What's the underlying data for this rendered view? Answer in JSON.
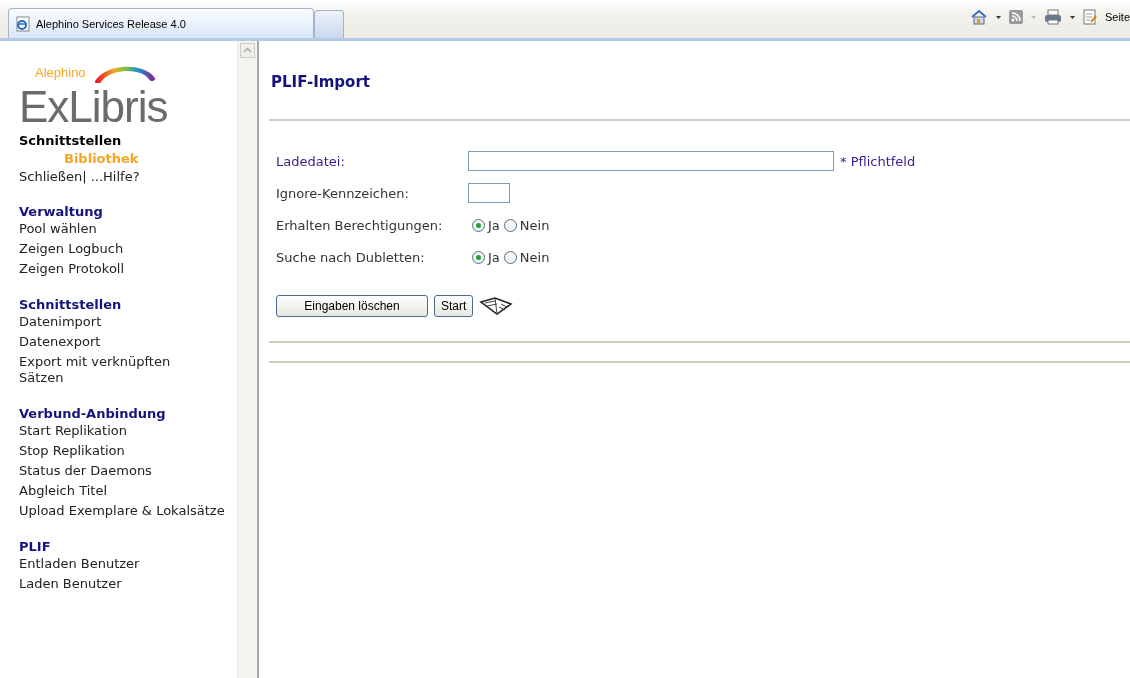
{
  "browser": {
    "tabs": [
      {
        "title": "Alephino Services Release 4.0",
        "selected": true
      },
      {
        "selected": false
      }
    ],
    "toolbar_label": "Seite"
  },
  "sidebar": {
    "logo_sub": "Alephino",
    "logo": "ExLibris",
    "context": "Schnittstellen",
    "library": "Bibliothek",
    "close_link": "Schließen|",
    "help_link": "...Hilfe?",
    "sections": [
      {
        "title": "Verwaltung",
        "items": [
          "Pool wählen",
          "Zeigen Logbuch",
          "Zeigen Protokoll"
        ]
      },
      {
        "title": "Schnittstellen",
        "items": [
          "Datenimport",
          "Datenexport",
          "Export mit verknüpften\nSätzen"
        ]
      },
      {
        "title": "Verbund-Anbindung",
        "items": [
          "Start Replikation",
          "Stop Replikation",
          "Status der Daemons",
          "Abgleich Titel",
          "Upload Exemplare & Lokalsätze"
        ]
      },
      {
        "title": "PLIF",
        "items": [
          "Entladen Benutzer",
          "Laden Benutzer"
        ]
      }
    ]
  },
  "page": {
    "title": "PLIF-Import",
    "fields": [
      {
        "kind": "wide_text",
        "label": "Ladedatei:",
        "required_note": "* Pflichtfeld"
      },
      {
        "kind": "short_text",
        "label": "Ignore-Kennzeichen:"
      },
      {
        "kind": "radio",
        "label": "Erhalten Berechtigungen:",
        "options": [
          {
            "label": "Ja",
            "selected": true
          },
          {
            "label": "Nein",
            "selected": false
          }
        ]
      },
      {
        "kind": "radio",
        "label": "Suche nach Dubletten:",
        "options": [
          {
            "label": "Ja",
            "selected": true
          },
          {
            "label": "Nein",
            "selected": false
          }
        ]
      }
    ],
    "buttons": [
      "Eingaben löschen",
      "Start"
    ]
  }
}
